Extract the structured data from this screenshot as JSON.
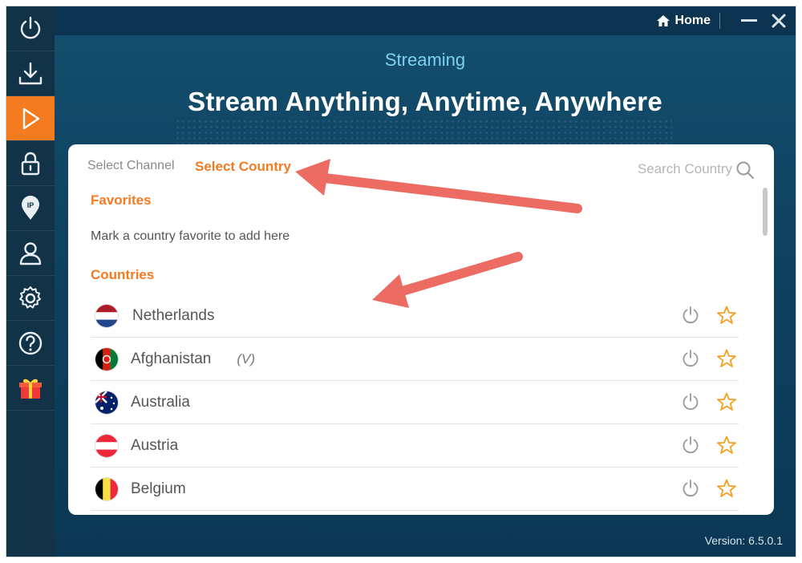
{
  "sidebar": {
    "items": [
      {
        "icon": "power-icon",
        "active": false
      },
      {
        "icon": "download-icon",
        "active": false
      },
      {
        "icon": "play-icon",
        "active": true
      },
      {
        "icon": "lock-icon",
        "active": false
      },
      {
        "icon": "ip-pin-icon",
        "active": false
      },
      {
        "icon": "user-icon",
        "active": false
      },
      {
        "icon": "gear-icon",
        "active": false
      },
      {
        "icon": "help-icon",
        "active": false
      },
      {
        "icon": "gift-icon",
        "active": false
      }
    ]
  },
  "titlebar": {
    "home_label": "Home"
  },
  "header": {
    "subtitle": "Streaming",
    "headline": "Stream Anything, Anytime, Anywhere"
  },
  "tabs": {
    "channel": "Select Channel",
    "country": "Select Country",
    "active": "country"
  },
  "search": {
    "placeholder": "Search Country"
  },
  "favorites": {
    "title": "Favorites",
    "empty_message": "Mark a country favorite to add here"
  },
  "countries": {
    "title": "Countries",
    "items": [
      {
        "name": "Netherlands",
        "badge": ""
      },
      {
        "name": "Afghanistan",
        "badge": "(V)"
      },
      {
        "name": "Australia",
        "badge": ""
      },
      {
        "name": "Austria",
        "badge": ""
      },
      {
        "name": "Belgium",
        "badge": ""
      }
    ]
  },
  "footer": {
    "version": "Version:  6.5.0.1"
  },
  "colors": {
    "accent": "#f47b20",
    "sidebar_bg": "#123247",
    "main_bg": "#0f4261",
    "annotation_arrow": "#ec6b63"
  }
}
